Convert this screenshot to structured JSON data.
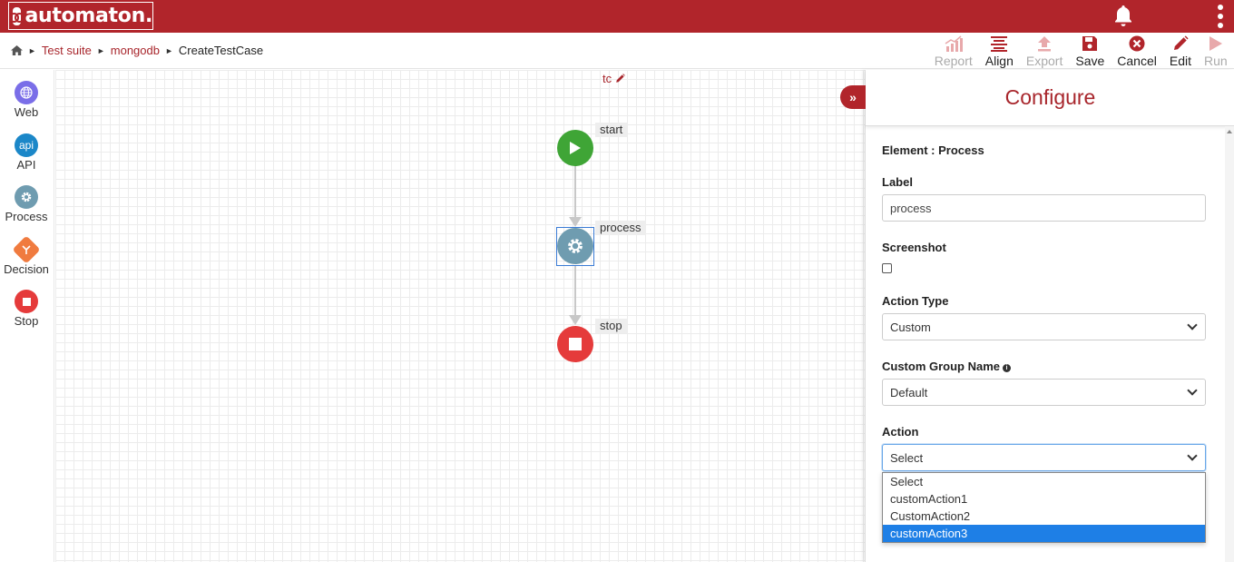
{
  "app": {
    "name": "automaton."
  },
  "breadcrumb": {
    "home": "home",
    "items": [
      "Test suite",
      "mongodb"
    ],
    "current": "CreateTestCase"
  },
  "toolbar": {
    "report": "Report",
    "align": "Align",
    "export": "Export",
    "save": "Save",
    "cancel": "Cancel",
    "edit": "Edit",
    "run": "Run"
  },
  "palette": {
    "web": "Web",
    "api": "API",
    "api_icon_text": "api",
    "process": "Process",
    "decision": "Decision",
    "stop": "Stop"
  },
  "canvas": {
    "title": "tc",
    "nodes": {
      "start": "start",
      "process": "process",
      "stop": "stop"
    }
  },
  "panel": {
    "title": "Configure",
    "element_line": "Element : Process",
    "label_label": "Label",
    "label_value": "process",
    "screenshot_label": "Screenshot",
    "action_type_label": "Action Type",
    "action_type_value": "Custom",
    "custom_group_label": "Custom Group Name",
    "custom_group_value": "Default",
    "action_label": "Action",
    "action_value": "Select",
    "action_options": [
      "Select",
      "customAction1",
      "CustomAction2",
      "customAction3"
    ],
    "highlighted_option": "customAction3"
  },
  "colors": {
    "brand": "#b1252b",
    "start": "#3fa536",
    "process": "#6f9cb0",
    "stop": "#e53b3b",
    "decision": "#f07b3f",
    "web": "#7a6ee8",
    "api": "#1b87c8",
    "highlight": "#1e7fe6"
  }
}
